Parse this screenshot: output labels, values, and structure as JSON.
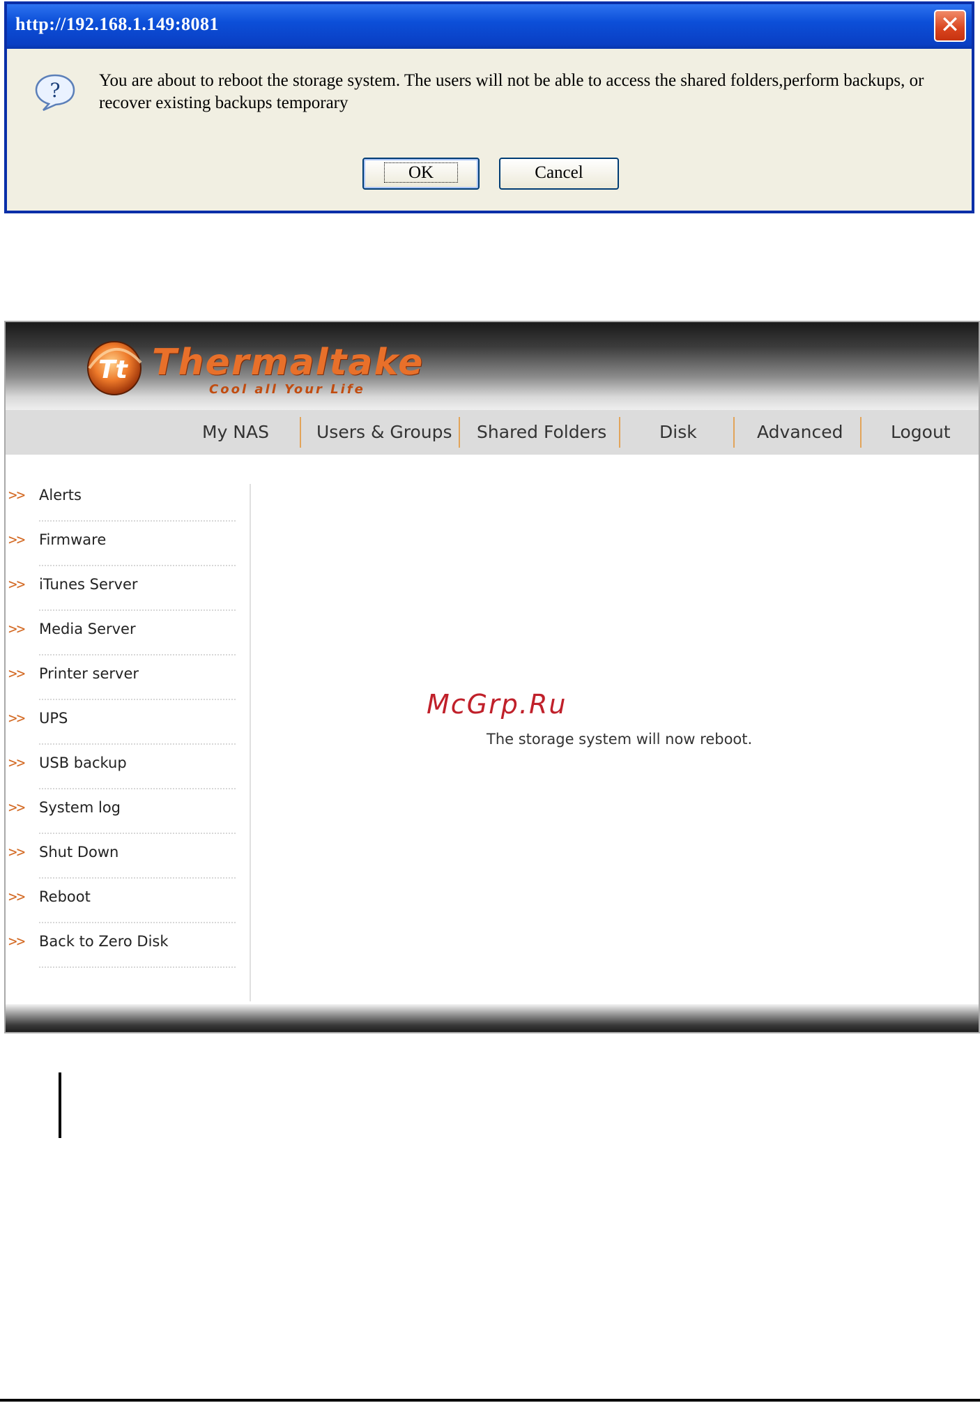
{
  "dialog": {
    "title": "http://192.168.1.149:8081",
    "message": "You are about to reboot the storage system. The users will not be able to access the shared folders,perform backups, or recover existing backups temporary",
    "ok_label": "OK",
    "cancel_label": "Cancel",
    "icon": "question-icon",
    "close_glyph": "✕"
  },
  "page": {
    "logo": {
      "text": "Thermaltake",
      "slogan": "Cool all Your Life",
      "mark": "Tt"
    },
    "nav": [
      "My NAS",
      "Users & Groups",
      "Shared Folders",
      "Disk",
      "Advanced",
      "Logout"
    ],
    "sidebar": [
      {
        "arrow": ">>",
        "label": "Alerts"
      },
      {
        "arrow": ">>",
        "label": "Firmware"
      },
      {
        "arrow": ">>",
        "label": "iTunes Server"
      },
      {
        "arrow": ">>",
        "label": "Media Server"
      },
      {
        "arrow": ">>",
        "label": "Printer server"
      },
      {
        "arrow": ">>",
        "label": "UPS"
      },
      {
        "arrow": ">>",
        "label": "USB backup"
      },
      {
        "arrow": ">>",
        "label": "System log"
      },
      {
        "arrow": ">>",
        "label": "Shut Down"
      },
      {
        "arrow": ">>",
        "label": "Reboot"
      },
      {
        "arrow": ">>",
        "label": "Back to Zero Disk"
      }
    ],
    "status_message": "The storage system will now reboot.",
    "watermark": "McGrp.Ru"
  },
  "colors": {
    "accent": "#e8702a",
    "dialog_border": "#0a2fa8",
    "watermark": "#c0202a"
  }
}
